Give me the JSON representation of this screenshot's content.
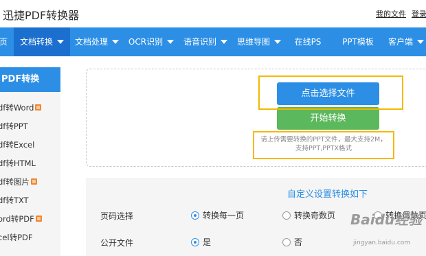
{
  "header": {
    "logo": "迅捷PDF转换器",
    "links": [
      "我的文件",
      "登录"
    ]
  },
  "nav": {
    "items": [
      {
        "label": "页",
        "caret": false
      },
      {
        "label": "文档转换",
        "caret": true,
        "active": true
      },
      {
        "label": "文档处理",
        "caret": true
      },
      {
        "label": "OCR识别",
        "caret": true
      },
      {
        "label": "语音识别",
        "caret": true
      },
      {
        "label": "思维导图",
        "caret": true
      },
      {
        "label": "在线PS",
        "caret": false
      },
      {
        "label": "PPT模板",
        "caret": false
      },
      {
        "label": "客户端",
        "caret": true
      }
    ]
  },
  "sidebar": {
    "title": "PDF转换",
    "items": [
      {
        "label": "df转Word",
        "vip": true
      },
      {
        "label": "df转PPT",
        "vip": false
      },
      {
        "label": "df转Excel",
        "vip": false
      },
      {
        "label": "df转HTML",
        "vip": false
      },
      {
        "label": "df转图片",
        "vip": true
      },
      {
        "label": "df转TXT",
        "vip": false
      },
      {
        "label": "ord转PDF",
        "vip": true
      },
      {
        "label": "cel转PDF",
        "vip": false
      }
    ]
  },
  "upload": {
    "select_button": "点击选择文件",
    "convert_button": "开始转换",
    "hint_line1": "请上传需要转换的PPT文件，最大支持2M，",
    "hint_line2": "支持PPT,PPTX格式"
  },
  "settings": {
    "title": "自定义设置转换如下",
    "rows": [
      {
        "label": "页码选择",
        "options": [
          {
            "text": "转换每一页",
            "selected": true
          },
          {
            "text": "转换奇数页",
            "selected": false
          },
          {
            "text": "转换偶数页",
            "selected": false
          }
        ]
      },
      {
        "label": "公开文件",
        "options": [
          {
            "text": "是",
            "selected": true
          },
          {
            "text": "否",
            "selected": false
          }
        ]
      }
    ]
  },
  "watermark": {
    "brand": "Baidu经验",
    "url": "jingyan.baidu.com"
  },
  "colors": {
    "brand_blue": "#2c8fe5",
    "green": "#5cb85c",
    "highlight": "#f5b800"
  }
}
